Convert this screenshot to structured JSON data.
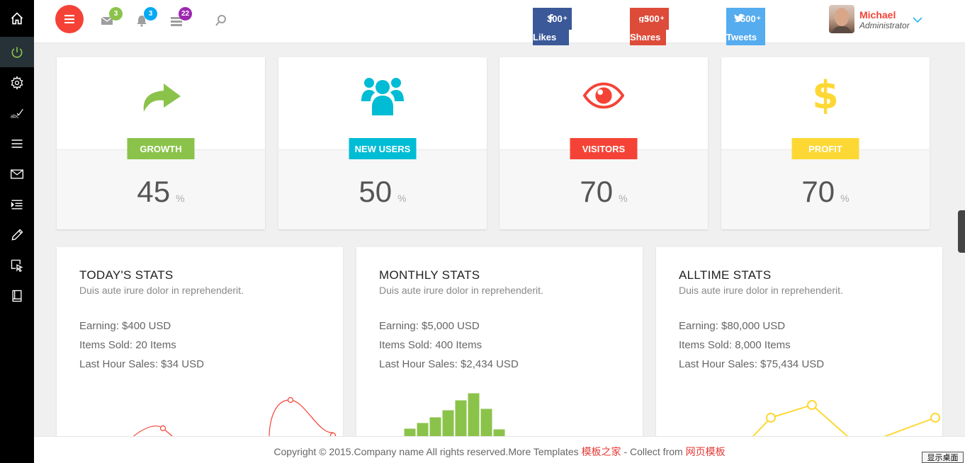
{
  "sidebar": {
    "items": [
      {
        "icon": "home-icon"
      },
      {
        "icon": "power-icon"
      },
      {
        "icon": "gear-icon"
      },
      {
        "icon": "spellcheck-icon"
      },
      {
        "icon": "list-icon"
      },
      {
        "icon": "mail-icon"
      },
      {
        "icon": "indent-list-icon"
      },
      {
        "icon": "pencil-icon"
      },
      {
        "icon": "cursor-select-icon"
      },
      {
        "icon": "book-icon"
      }
    ]
  },
  "topbar": {
    "messages_count": "3",
    "notifications_count": "3",
    "tasks_count": "22",
    "facebook": {
      "count": "300",
      "sup": "+",
      "label": "Likes",
      "color": "#3b5998"
    },
    "googleplus": {
      "count": "500",
      "sup": "+",
      "label": "Shares",
      "color": "#dd4b39"
    },
    "twitter": {
      "count": "500",
      "sup": "+",
      "label": "Tweets",
      "color": "#55acee"
    },
    "user": {
      "name": "Michael",
      "role": "Administrator"
    }
  },
  "stats": [
    {
      "label": "GROWTH",
      "value": "45",
      "unit": "%",
      "color": "#8bc34a",
      "icon": "share-arrow-icon"
    },
    {
      "label": "NEW USERS",
      "value": "50",
      "unit": "%",
      "color": "#00bcd4",
      "icon": "users-icon"
    },
    {
      "label": "VISITORS",
      "value": "70",
      "unit": "%",
      "color": "#f44336",
      "icon": "eye-icon"
    },
    {
      "label": "PROFIT",
      "value": "70",
      "unit": "%",
      "color": "#fdd835",
      "icon": "dollar-icon"
    }
  ],
  "panels": [
    {
      "title": "TODAY'S STATS",
      "subtitle": "Duis aute irure dolor in reprehenderit.",
      "earning": "Earning: $400 USD",
      "items": "Items Sold: 20 Items",
      "last_hour": "Last Hour Sales: $34 USD"
    },
    {
      "title": "MONTHLY STATS",
      "subtitle": "Duis aute irure dolor in reprehenderit.",
      "earning": "Earning: $5,000 USD",
      "items": "Items Sold: 400 Items",
      "last_hour": "Last Hour Sales: $2,434 USD"
    },
    {
      "title": "ALLTIME STATS",
      "subtitle": "Duis aute irure dolor in reprehenderit.",
      "earning": "Earning: $80,000 USD",
      "items": "Items Sold: 8,000 Items",
      "last_hour": "Last Hour Sales: $75,434 USD"
    }
  ],
  "footer": {
    "text": "Copyright © 2015.Company name All rights reserved.More Templates ",
    "link1": "模板之家",
    "middle": " - Collect from ",
    "link2": "网页模板"
  },
  "desktop_button": "显示桌面"
}
